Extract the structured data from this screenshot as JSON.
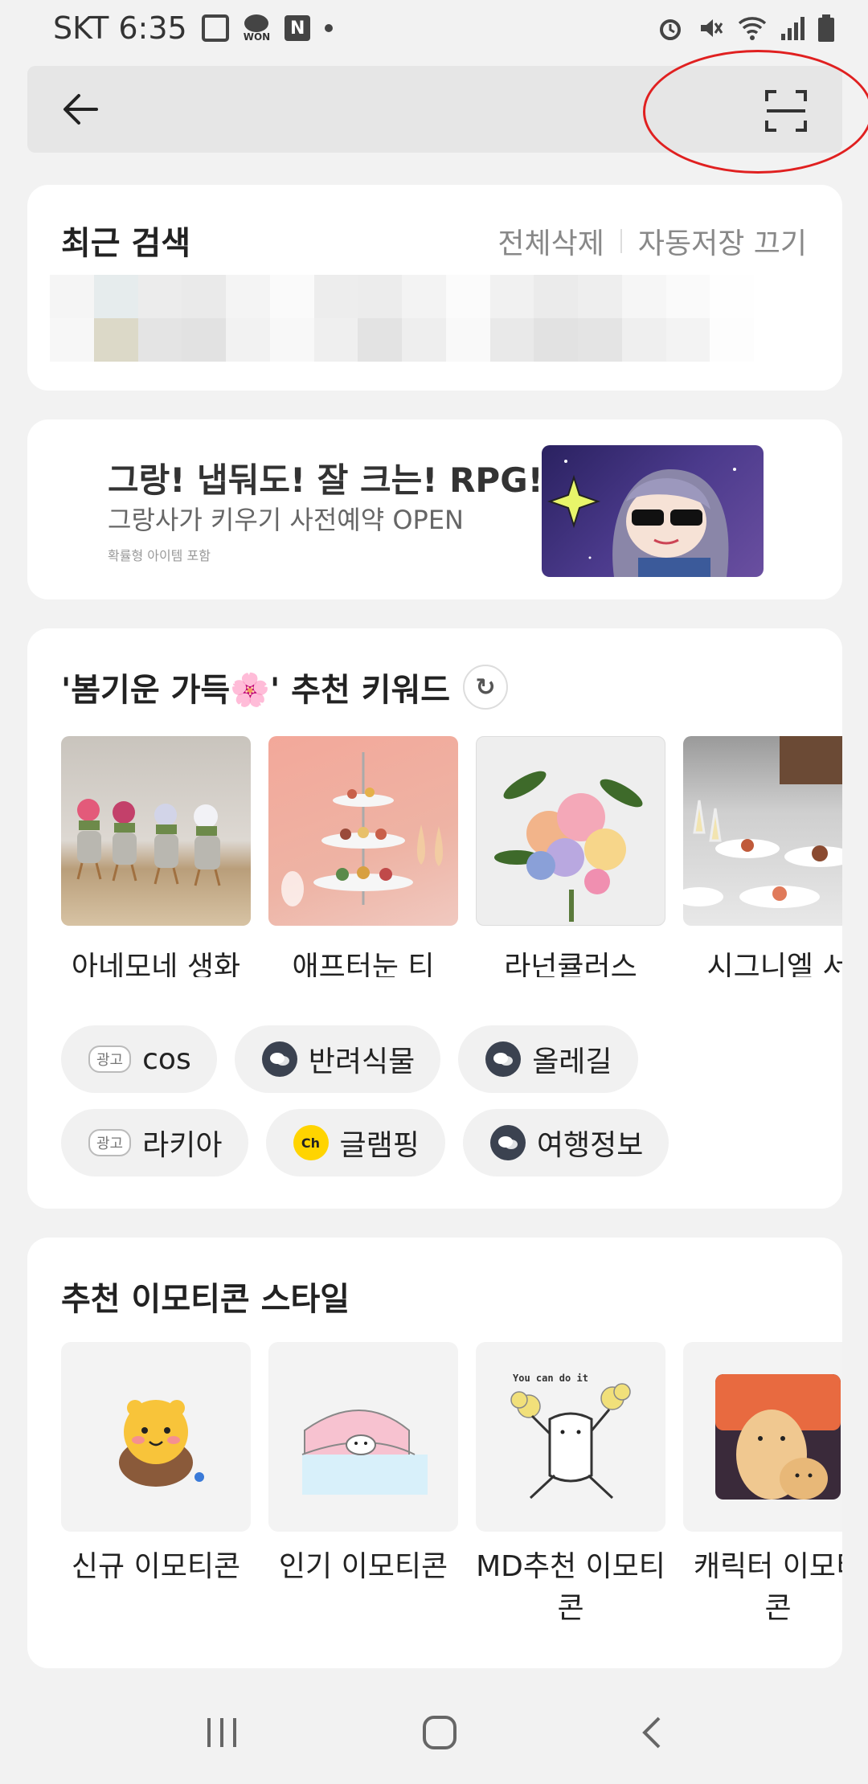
{
  "status_bar": {
    "carrier_time": "SKT 6:35",
    "won_label": "WON",
    "n_label": "N"
  },
  "search": {
    "placeholder": ""
  },
  "recent": {
    "title": "최근 검색",
    "delete_all": "전체삭제",
    "autosave_off": "자동저장 끄기"
  },
  "promo": {
    "headline": "그랑! 냅둬도! 잘 크는! RPG!",
    "subline": "그랑사가 키우기 사전예약 OPEN",
    "note": "확률형 아이템 포함"
  },
  "keywords": {
    "title": "'봄기운 가득🌸' 추천 키워드",
    "thumbs": [
      {
        "label": "아네모네 생화"
      },
      {
        "label": "애프터눈 티"
      },
      {
        "label": "라넌큘러스"
      },
      {
        "label": "시그니엘 서"
      }
    ],
    "chips_row1": [
      {
        "badge": "광고",
        "label": "cos",
        "icon": "ad-badge"
      },
      {
        "label": "반려식물",
        "icon": "openchat-icon"
      },
      {
        "label": "올레길",
        "icon": "openchat-icon"
      }
    ],
    "chips_row2": [
      {
        "badge": "광고",
        "label": "라키아",
        "icon": "ad-badge"
      },
      {
        "label": "글램핑",
        "icon": "channel-icon",
        "icon_text": "Ch"
      },
      {
        "label": "여행정보",
        "icon": "openchat-icon"
      }
    ]
  },
  "emoticons": {
    "title": "추천 이모티콘 스타일",
    "tiles": [
      {
        "label": "신규 이모티콘"
      },
      {
        "label": "인기 이모티콘"
      },
      {
        "label": "MD추천 이모티콘",
        "caption": "You can do it"
      },
      {
        "label": "캐릭터 이모티콘"
      }
    ]
  },
  "colors": {
    "accent_yellow": "#ffd400",
    "highlight_red": "#e02020"
  }
}
